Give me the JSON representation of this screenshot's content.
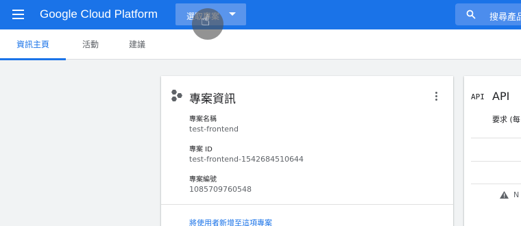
{
  "header": {
    "brand": "Google Cloud Platform",
    "project_select_label": "選取專案",
    "search_placeholder": "搜尋產品"
  },
  "tabs": [
    {
      "label": "資訊主頁",
      "active": true
    },
    {
      "label": "活動",
      "active": false
    },
    {
      "label": "建議",
      "active": false
    }
  ],
  "project_info": {
    "title": "專案資訊",
    "fields": [
      {
        "label": "專案名稱",
        "value": "test-frontend"
      },
      {
        "label": "專案 ID",
        "value": "test-frontend-1542684510644"
      },
      {
        "label": "專案編號",
        "value": "1085709760548"
      }
    ],
    "link": "將使用者新增至這項專案"
  },
  "api_card": {
    "icon_text": "API",
    "title": "API",
    "subtitle": "要求 (每",
    "notice": "N"
  },
  "colors": {
    "brand_blue": "#1a73e8",
    "page_bg": "#f1f3f4"
  },
  "icons": [
    "menu-icon",
    "chevron-down-icon",
    "hand-cursor-icon",
    "search-icon",
    "hexagons-icon",
    "more-vert-icon",
    "warning-icon"
  ]
}
